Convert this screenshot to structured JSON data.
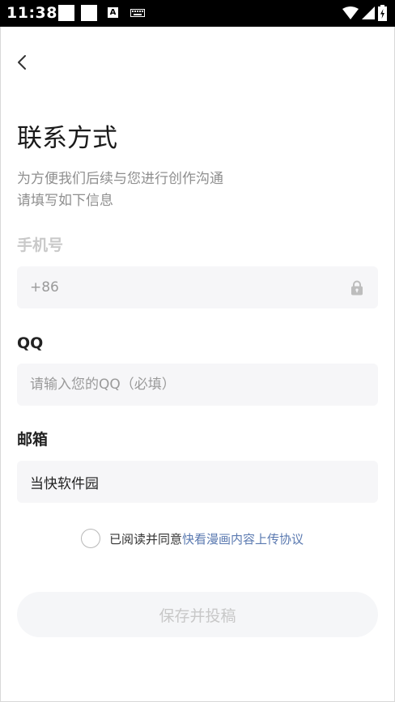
{
  "status_bar": {
    "time": "11:38",
    "icons": [
      "notification-square-icon",
      "notification-square-icon",
      "text-a-icon",
      "keyboard-icon",
      "wifi-icon",
      "signal-icon",
      "battery-charging-icon"
    ],
    "a_glyph": "A"
  },
  "header": {
    "back_icon": "chevron-left-icon"
  },
  "page": {
    "title": "联系方式",
    "subtitle_line1": "为方便我们后续与您进行创作沟通",
    "subtitle_line2": "请填写如下信息"
  },
  "form": {
    "phone": {
      "label": "手机号",
      "value": "+86",
      "icon": "lock-icon"
    },
    "qq": {
      "label": "QQ",
      "placeholder": "请输入您的QQ（必填）",
      "value": ""
    },
    "email": {
      "label": "邮箱",
      "value": "当快软件园"
    }
  },
  "agreement": {
    "text": "已阅读并同意",
    "link": "快看漫画内容上传协议",
    "checked": false
  },
  "submit": {
    "label": "保存并投稿"
  },
  "colors": {
    "link": "#5a79b0",
    "field_bg": "#f6f6f8",
    "disabled_text": "#c8c8c8",
    "status_bar": "#000000"
  }
}
